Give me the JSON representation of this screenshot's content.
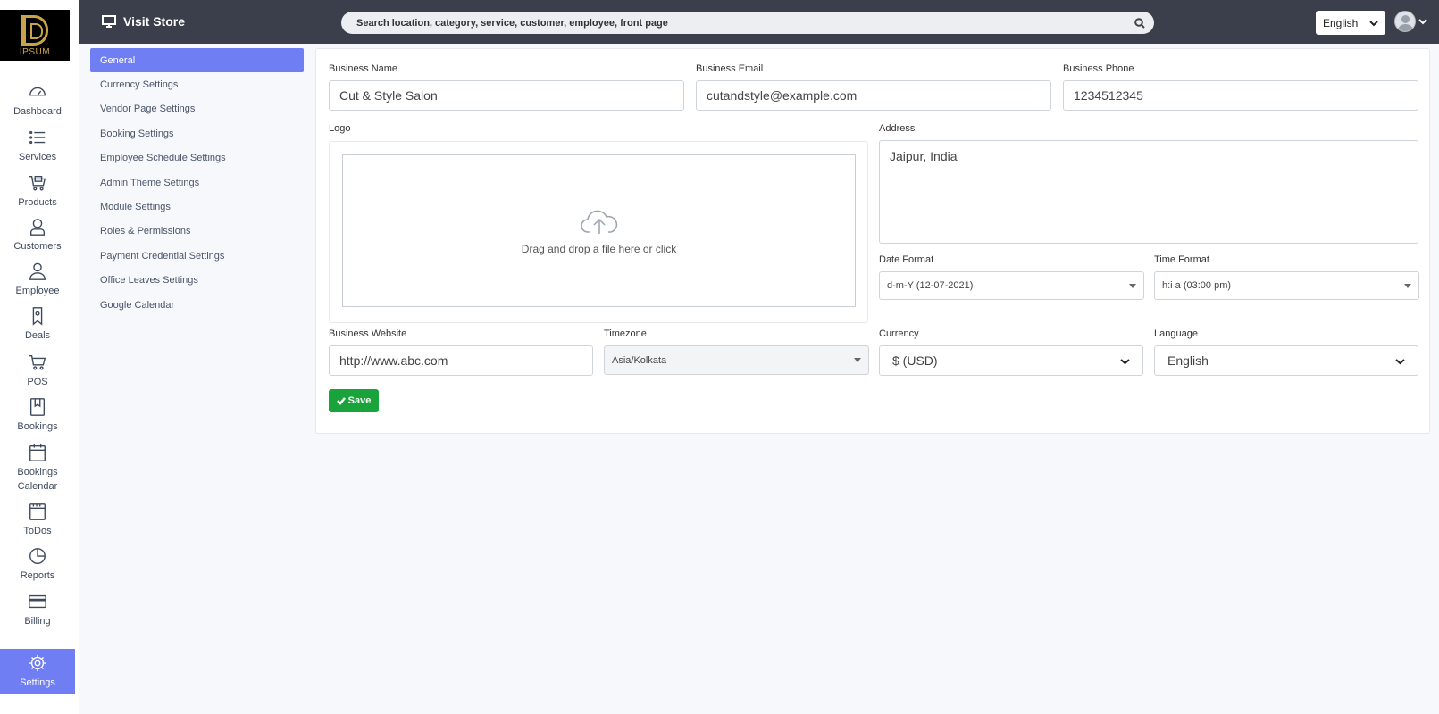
{
  "brand": {
    "logo_text": "IPSUM"
  },
  "sidebar": {
    "items": [
      {
        "label": "Dashboard"
      },
      {
        "label": "Services"
      },
      {
        "label": "Products"
      },
      {
        "label": "Customers"
      },
      {
        "label": "Employee"
      },
      {
        "label": "Deals"
      },
      {
        "label": "POS"
      },
      {
        "label": "Bookings"
      },
      {
        "label": "Bookings Calendar"
      },
      {
        "label": "ToDos"
      },
      {
        "label": "Reports"
      },
      {
        "label": "Billing"
      },
      {
        "label": "Settings",
        "active": true
      }
    ]
  },
  "topbar": {
    "visit_store": "Visit Store",
    "search_placeholder": "Search location, category, service, customer, employee, front page",
    "language": "English"
  },
  "settings_menu": {
    "items": [
      {
        "label": "General",
        "active": true
      },
      {
        "label": "Currency Settings"
      },
      {
        "label": "Vendor Page Settings"
      },
      {
        "label": "Booking Settings"
      },
      {
        "label": "Employee Schedule Settings"
      },
      {
        "label": "Admin Theme Settings"
      },
      {
        "label": "Module Settings"
      },
      {
        "label": "Roles & Permissions"
      },
      {
        "label": "Payment Credential Settings"
      },
      {
        "label": "Office Leaves Settings"
      },
      {
        "label": "Google Calendar"
      }
    ]
  },
  "form": {
    "business_name": {
      "label": "Business Name",
      "value": "Cut & Style Salon"
    },
    "business_email": {
      "label": "Business Email",
      "value": "cutandstyle@example.com"
    },
    "business_phone": {
      "label": "Business Phone",
      "value": "1234512345"
    },
    "logo": {
      "label": "Logo",
      "dropzone_text": "Drag and drop a file here or click"
    },
    "address": {
      "label": "Address",
      "value": "Jaipur, India"
    },
    "date_format": {
      "label": "Date Format",
      "value": "d-m-Y (12-07-2021)"
    },
    "time_format": {
      "label": "Time Format",
      "value": "h:i a (03:00 pm)"
    },
    "business_website": {
      "label": "Business Website",
      "value": "http://www.abc.com"
    },
    "timezone": {
      "label": "Timezone",
      "value": "Asia/Kolkata"
    },
    "currency": {
      "label": "Currency",
      "value": "$ (USD)"
    },
    "language": {
      "label": "Language",
      "value": "English"
    },
    "save_label": "Save"
  },
  "colors": {
    "topbar": "#3b3f4c",
    "accent": "#6f7ef2",
    "save": "#1aa33a"
  }
}
